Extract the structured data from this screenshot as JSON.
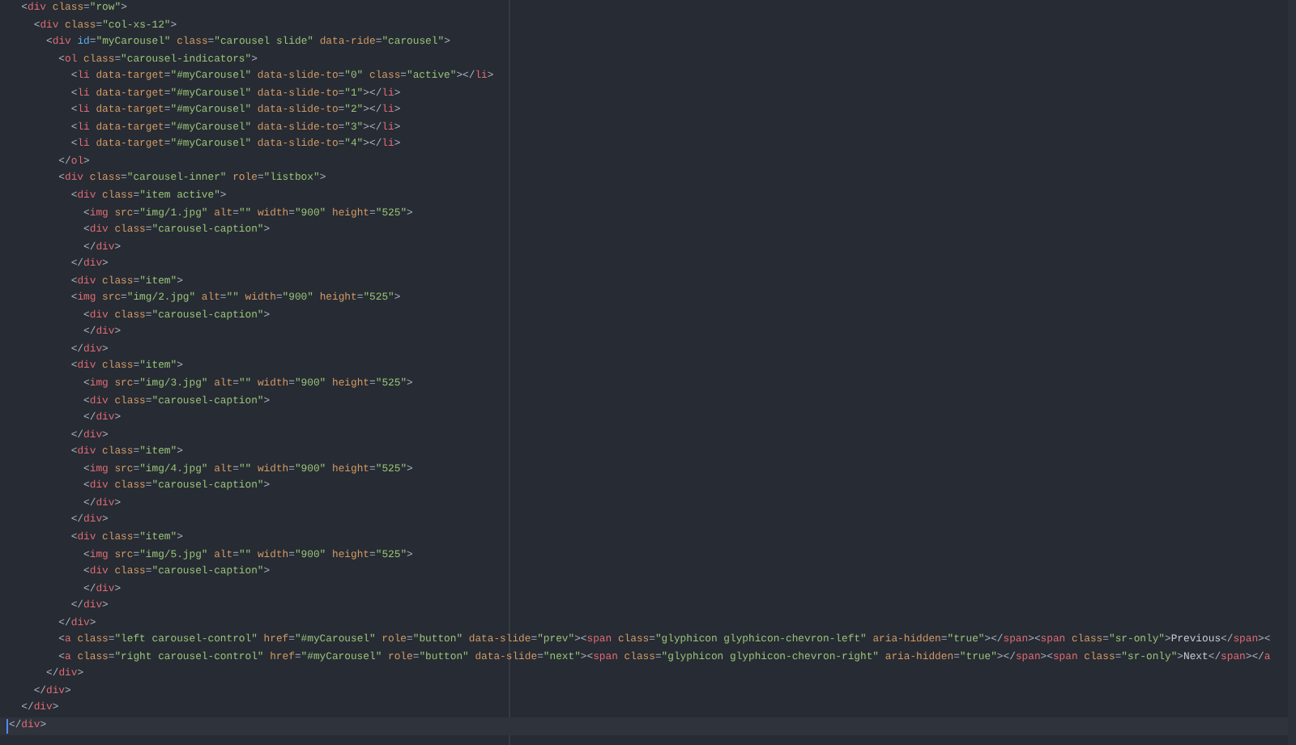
{
  "editor": {
    "lines": [
      {
        "current": false,
        "tokens": [
          {
            "kind": "punct",
            "text": "  <"
          },
          {
            "kind": "tag",
            "text": "div"
          },
          {
            "kind": "attr",
            "text": " class"
          },
          {
            "kind": "punct",
            "text": "="
          },
          {
            "kind": "string",
            "text": "\"row\""
          },
          {
            "kind": "punct",
            "text": ">"
          }
        ]
      },
      {
        "current": false,
        "tokens": [
          {
            "kind": "punct",
            "text": "    <"
          },
          {
            "kind": "tag",
            "text": "div"
          },
          {
            "kind": "attr",
            "text": " class"
          },
          {
            "kind": "punct",
            "text": "="
          },
          {
            "kind": "string",
            "text": "\"col-xs-12\""
          },
          {
            "kind": "punct",
            "text": ">"
          }
        ]
      },
      {
        "current": false,
        "tokens": [
          {
            "kind": "punct",
            "text": "      <"
          },
          {
            "kind": "tag",
            "text": "div"
          },
          {
            "kind": "keyword",
            "text": " id"
          },
          {
            "kind": "punct",
            "text": "="
          },
          {
            "kind": "string",
            "text": "\"myCarousel\""
          },
          {
            "kind": "attr",
            "text": " class"
          },
          {
            "kind": "punct",
            "text": "="
          },
          {
            "kind": "string",
            "text": "\"carousel slide\""
          },
          {
            "kind": "attr",
            "text": " data-ride"
          },
          {
            "kind": "punct",
            "text": "="
          },
          {
            "kind": "string",
            "text": "\"carousel\""
          },
          {
            "kind": "punct",
            "text": ">"
          }
        ]
      },
      {
        "current": false,
        "tokens": [
          {
            "kind": "punct",
            "text": "        <"
          },
          {
            "kind": "tag",
            "text": "ol"
          },
          {
            "kind": "attr",
            "text": " class"
          },
          {
            "kind": "punct",
            "text": "="
          },
          {
            "kind": "string",
            "text": "\"carousel-indicators\""
          },
          {
            "kind": "punct",
            "text": ">"
          }
        ]
      },
      {
        "current": false,
        "tokens": [
          {
            "kind": "punct",
            "text": "          <"
          },
          {
            "kind": "tag",
            "text": "li"
          },
          {
            "kind": "attr",
            "text": " data-target"
          },
          {
            "kind": "punct",
            "text": "="
          },
          {
            "kind": "string",
            "text": "\"#myCarousel\""
          },
          {
            "kind": "attr",
            "text": " data-slide-to"
          },
          {
            "kind": "punct",
            "text": "="
          },
          {
            "kind": "string",
            "text": "\"0\""
          },
          {
            "kind": "attr",
            "text": " class"
          },
          {
            "kind": "punct",
            "text": "="
          },
          {
            "kind": "string",
            "text": "\"active\""
          },
          {
            "kind": "punct",
            "text": "></"
          },
          {
            "kind": "tag",
            "text": "li"
          },
          {
            "kind": "punct",
            "text": ">"
          }
        ]
      },
      {
        "current": false,
        "tokens": [
          {
            "kind": "punct",
            "text": "          <"
          },
          {
            "kind": "tag",
            "text": "li"
          },
          {
            "kind": "attr",
            "text": " data-target"
          },
          {
            "kind": "punct",
            "text": "="
          },
          {
            "kind": "string",
            "text": "\"#myCarousel\""
          },
          {
            "kind": "attr",
            "text": " data-slide-to"
          },
          {
            "kind": "punct",
            "text": "="
          },
          {
            "kind": "string",
            "text": "\"1\""
          },
          {
            "kind": "punct",
            "text": "></"
          },
          {
            "kind": "tag",
            "text": "li"
          },
          {
            "kind": "punct",
            "text": ">"
          }
        ]
      },
      {
        "current": false,
        "tokens": [
          {
            "kind": "punct",
            "text": "          <"
          },
          {
            "kind": "tag",
            "text": "li"
          },
          {
            "kind": "attr",
            "text": " data-target"
          },
          {
            "kind": "punct",
            "text": "="
          },
          {
            "kind": "string",
            "text": "\"#myCarousel\""
          },
          {
            "kind": "attr",
            "text": " data-slide-to"
          },
          {
            "kind": "punct",
            "text": "="
          },
          {
            "kind": "string",
            "text": "\"2\""
          },
          {
            "kind": "punct",
            "text": "></"
          },
          {
            "kind": "tag",
            "text": "li"
          },
          {
            "kind": "punct",
            "text": ">"
          }
        ]
      },
      {
        "current": false,
        "tokens": [
          {
            "kind": "punct",
            "text": "          <"
          },
          {
            "kind": "tag",
            "text": "li"
          },
          {
            "kind": "attr",
            "text": " data-target"
          },
          {
            "kind": "punct",
            "text": "="
          },
          {
            "kind": "string",
            "text": "\"#myCarousel\""
          },
          {
            "kind": "attr",
            "text": " data-slide-to"
          },
          {
            "kind": "punct",
            "text": "="
          },
          {
            "kind": "string",
            "text": "\"3\""
          },
          {
            "kind": "punct",
            "text": "></"
          },
          {
            "kind": "tag",
            "text": "li"
          },
          {
            "kind": "punct",
            "text": ">"
          }
        ]
      },
      {
        "current": false,
        "tokens": [
          {
            "kind": "punct",
            "text": "          <"
          },
          {
            "kind": "tag",
            "text": "li"
          },
          {
            "kind": "attr",
            "text": " data-target"
          },
          {
            "kind": "punct",
            "text": "="
          },
          {
            "kind": "string",
            "text": "\"#myCarousel\""
          },
          {
            "kind": "attr",
            "text": " data-slide-to"
          },
          {
            "kind": "punct",
            "text": "="
          },
          {
            "kind": "string",
            "text": "\"4\""
          },
          {
            "kind": "punct",
            "text": "></"
          },
          {
            "kind": "tag",
            "text": "li"
          },
          {
            "kind": "punct",
            "text": ">"
          }
        ]
      },
      {
        "current": false,
        "tokens": [
          {
            "kind": "punct",
            "text": "        </"
          },
          {
            "kind": "tag",
            "text": "ol"
          },
          {
            "kind": "punct",
            "text": ">"
          }
        ]
      },
      {
        "current": false,
        "tokens": [
          {
            "kind": "punct",
            "text": "        <"
          },
          {
            "kind": "tag",
            "text": "div"
          },
          {
            "kind": "attr",
            "text": " class"
          },
          {
            "kind": "punct",
            "text": "="
          },
          {
            "kind": "string",
            "text": "\"carousel-inner\""
          },
          {
            "kind": "attr",
            "text": " role"
          },
          {
            "kind": "punct",
            "text": "="
          },
          {
            "kind": "string",
            "text": "\"listbox\""
          },
          {
            "kind": "punct",
            "text": ">"
          }
        ]
      },
      {
        "current": false,
        "tokens": [
          {
            "kind": "punct",
            "text": "          <"
          },
          {
            "kind": "tag",
            "text": "div"
          },
          {
            "kind": "attr",
            "text": " class"
          },
          {
            "kind": "punct",
            "text": "="
          },
          {
            "kind": "string",
            "text": "\"item active\""
          },
          {
            "kind": "punct",
            "text": ">"
          }
        ]
      },
      {
        "current": false,
        "tokens": [
          {
            "kind": "punct",
            "text": "            <"
          },
          {
            "kind": "tag",
            "text": "img"
          },
          {
            "kind": "attr",
            "text": " src"
          },
          {
            "kind": "punct",
            "text": "="
          },
          {
            "kind": "string",
            "text": "\"img/1.jpg\""
          },
          {
            "kind": "attr",
            "text": " alt"
          },
          {
            "kind": "punct",
            "text": "="
          },
          {
            "kind": "string",
            "text": "\"\""
          },
          {
            "kind": "attr",
            "text": " width"
          },
          {
            "kind": "punct",
            "text": "="
          },
          {
            "kind": "string",
            "text": "\"900\""
          },
          {
            "kind": "attr",
            "text": " height"
          },
          {
            "kind": "punct",
            "text": "="
          },
          {
            "kind": "string",
            "text": "\"525\""
          },
          {
            "kind": "punct",
            "text": ">"
          }
        ]
      },
      {
        "current": false,
        "tokens": [
          {
            "kind": "punct",
            "text": "            <"
          },
          {
            "kind": "tag",
            "text": "div"
          },
          {
            "kind": "attr",
            "text": " class"
          },
          {
            "kind": "punct",
            "text": "="
          },
          {
            "kind": "string",
            "text": "\"carousel-caption\""
          },
          {
            "kind": "punct",
            "text": ">"
          }
        ]
      },
      {
        "current": false,
        "tokens": [
          {
            "kind": "punct",
            "text": "            </"
          },
          {
            "kind": "tag",
            "text": "div"
          },
          {
            "kind": "punct",
            "text": ">"
          }
        ]
      },
      {
        "current": false,
        "tokens": [
          {
            "kind": "punct",
            "text": "          </"
          },
          {
            "kind": "tag",
            "text": "div"
          },
          {
            "kind": "punct",
            "text": ">"
          }
        ]
      },
      {
        "current": false,
        "tokens": [
          {
            "kind": "punct",
            "text": "          <"
          },
          {
            "kind": "tag",
            "text": "div"
          },
          {
            "kind": "attr",
            "text": " class"
          },
          {
            "kind": "punct",
            "text": "="
          },
          {
            "kind": "string",
            "text": "\"item\""
          },
          {
            "kind": "punct",
            "text": ">"
          }
        ]
      },
      {
        "current": false,
        "tokens": [
          {
            "kind": "punct",
            "text": "          <"
          },
          {
            "kind": "tag",
            "text": "img"
          },
          {
            "kind": "attr",
            "text": " src"
          },
          {
            "kind": "punct",
            "text": "="
          },
          {
            "kind": "string",
            "text": "\"img/2.jpg\""
          },
          {
            "kind": "attr",
            "text": " alt"
          },
          {
            "kind": "punct",
            "text": "="
          },
          {
            "kind": "string",
            "text": "\"\""
          },
          {
            "kind": "attr",
            "text": " width"
          },
          {
            "kind": "punct",
            "text": "="
          },
          {
            "kind": "string",
            "text": "\"900\""
          },
          {
            "kind": "attr",
            "text": " height"
          },
          {
            "kind": "punct",
            "text": "="
          },
          {
            "kind": "string",
            "text": "\"525\""
          },
          {
            "kind": "punct",
            "text": ">"
          }
        ]
      },
      {
        "current": false,
        "tokens": [
          {
            "kind": "punct",
            "text": "            <"
          },
          {
            "kind": "tag",
            "text": "div"
          },
          {
            "kind": "attr",
            "text": " class"
          },
          {
            "kind": "punct",
            "text": "="
          },
          {
            "kind": "string",
            "text": "\"carousel-caption\""
          },
          {
            "kind": "punct",
            "text": ">"
          }
        ]
      },
      {
        "current": false,
        "tokens": [
          {
            "kind": "punct",
            "text": "            </"
          },
          {
            "kind": "tag",
            "text": "div"
          },
          {
            "kind": "punct",
            "text": ">"
          }
        ]
      },
      {
        "current": false,
        "tokens": [
          {
            "kind": "punct",
            "text": "          </"
          },
          {
            "kind": "tag",
            "text": "div"
          },
          {
            "kind": "punct",
            "text": ">"
          }
        ]
      },
      {
        "current": false,
        "tokens": [
          {
            "kind": "punct",
            "text": "          <"
          },
          {
            "kind": "tag",
            "text": "div"
          },
          {
            "kind": "attr",
            "text": " class"
          },
          {
            "kind": "punct",
            "text": "="
          },
          {
            "kind": "string",
            "text": "\"item\""
          },
          {
            "kind": "punct",
            "text": ">"
          }
        ]
      },
      {
        "current": false,
        "tokens": [
          {
            "kind": "punct",
            "text": "            <"
          },
          {
            "kind": "tag",
            "text": "img"
          },
          {
            "kind": "attr",
            "text": " src"
          },
          {
            "kind": "punct",
            "text": "="
          },
          {
            "kind": "string",
            "text": "\"img/3.jpg\""
          },
          {
            "kind": "attr",
            "text": " alt"
          },
          {
            "kind": "punct",
            "text": "="
          },
          {
            "kind": "string",
            "text": "\"\""
          },
          {
            "kind": "attr",
            "text": " width"
          },
          {
            "kind": "punct",
            "text": "="
          },
          {
            "kind": "string",
            "text": "\"900\""
          },
          {
            "kind": "attr",
            "text": " height"
          },
          {
            "kind": "punct",
            "text": "="
          },
          {
            "kind": "string",
            "text": "\"525\""
          },
          {
            "kind": "punct",
            "text": ">"
          }
        ]
      },
      {
        "current": false,
        "tokens": [
          {
            "kind": "punct",
            "text": "            <"
          },
          {
            "kind": "tag",
            "text": "div"
          },
          {
            "kind": "attr",
            "text": " class"
          },
          {
            "kind": "punct",
            "text": "="
          },
          {
            "kind": "string",
            "text": "\"carousel-caption\""
          },
          {
            "kind": "punct",
            "text": ">"
          }
        ]
      },
      {
        "current": false,
        "tokens": [
          {
            "kind": "punct",
            "text": "            </"
          },
          {
            "kind": "tag",
            "text": "div"
          },
          {
            "kind": "punct",
            "text": ">"
          }
        ]
      },
      {
        "current": false,
        "tokens": [
          {
            "kind": "punct",
            "text": "          </"
          },
          {
            "kind": "tag",
            "text": "div"
          },
          {
            "kind": "punct",
            "text": ">"
          }
        ]
      },
      {
        "current": false,
        "tokens": [
          {
            "kind": "punct",
            "text": "          <"
          },
          {
            "kind": "tag",
            "text": "div"
          },
          {
            "kind": "attr",
            "text": " class"
          },
          {
            "kind": "punct",
            "text": "="
          },
          {
            "kind": "string",
            "text": "\"item\""
          },
          {
            "kind": "punct",
            "text": ">"
          }
        ]
      },
      {
        "current": false,
        "tokens": [
          {
            "kind": "punct",
            "text": "            <"
          },
          {
            "kind": "tag",
            "text": "img"
          },
          {
            "kind": "attr",
            "text": " src"
          },
          {
            "kind": "punct",
            "text": "="
          },
          {
            "kind": "string",
            "text": "\"img/4.jpg\""
          },
          {
            "kind": "attr",
            "text": " alt"
          },
          {
            "kind": "punct",
            "text": "="
          },
          {
            "kind": "string",
            "text": "\"\""
          },
          {
            "kind": "attr",
            "text": " width"
          },
          {
            "kind": "punct",
            "text": "="
          },
          {
            "kind": "string",
            "text": "\"900\""
          },
          {
            "kind": "attr",
            "text": " height"
          },
          {
            "kind": "punct",
            "text": "="
          },
          {
            "kind": "string",
            "text": "\"525\""
          },
          {
            "kind": "punct",
            "text": ">"
          }
        ]
      },
      {
        "current": false,
        "tokens": [
          {
            "kind": "punct",
            "text": "            <"
          },
          {
            "kind": "tag",
            "text": "div"
          },
          {
            "kind": "attr",
            "text": " class"
          },
          {
            "kind": "punct",
            "text": "="
          },
          {
            "kind": "string",
            "text": "\"carousel-caption\""
          },
          {
            "kind": "punct",
            "text": ">"
          }
        ]
      },
      {
        "current": false,
        "tokens": [
          {
            "kind": "punct",
            "text": "            </"
          },
          {
            "kind": "tag",
            "text": "div"
          },
          {
            "kind": "punct",
            "text": ">"
          }
        ]
      },
      {
        "current": false,
        "tokens": [
          {
            "kind": "punct",
            "text": "          </"
          },
          {
            "kind": "tag",
            "text": "div"
          },
          {
            "kind": "punct",
            "text": ">"
          }
        ]
      },
      {
        "current": false,
        "tokens": [
          {
            "kind": "punct",
            "text": "          <"
          },
          {
            "kind": "tag",
            "text": "div"
          },
          {
            "kind": "attr",
            "text": " class"
          },
          {
            "kind": "punct",
            "text": "="
          },
          {
            "kind": "string",
            "text": "\"item\""
          },
          {
            "kind": "punct",
            "text": ">"
          }
        ]
      },
      {
        "current": false,
        "tokens": [
          {
            "kind": "punct",
            "text": "            <"
          },
          {
            "kind": "tag",
            "text": "img"
          },
          {
            "kind": "attr",
            "text": " src"
          },
          {
            "kind": "punct",
            "text": "="
          },
          {
            "kind": "string",
            "text": "\"img/5.jpg\""
          },
          {
            "kind": "attr",
            "text": " alt"
          },
          {
            "kind": "punct",
            "text": "="
          },
          {
            "kind": "string",
            "text": "\"\""
          },
          {
            "kind": "attr",
            "text": " width"
          },
          {
            "kind": "punct",
            "text": "="
          },
          {
            "kind": "string",
            "text": "\"900\""
          },
          {
            "kind": "attr",
            "text": " height"
          },
          {
            "kind": "punct",
            "text": "="
          },
          {
            "kind": "string",
            "text": "\"525\""
          },
          {
            "kind": "punct",
            "text": ">"
          }
        ]
      },
      {
        "current": false,
        "tokens": [
          {
            "kind": "punct",
            "text": "            <"
          },
          {
            "kind": "tag",
            "text": "div"
          },
          {
            "kind": "attr",
            "text": " class"
          },
          {
            "kind": "punct",
            "text": "="
          },
          {
            "kind": "string",
            "text": "\"carousel-caption\""
          },
          {
            "kind": "punct",
            "text": ">"
          }
        ]
      },
      {
        "current": false,
        "tokens": [
          {
            "kind": "punct",
            "text": "            </"
          },
          {
            "kind": "tag",
            "text": "div"
          },
          {
            "kind": "punct",
            "text": ">"
          }
        ]
      },
      {
        "current": false,
        "tokens": [
          {
            "kind": "punct",
            "text": "          </"
          },
          {
            "kind": "tag",
            "text": "div"
          },
          {
            "kind": "punct",
            "text": ">"
          }
        ]
      },
      {
        "current": false,
        "tokens": [
          {
            "kind": "punct",
            "text": "        </"
          },
          {
            "kind": "tag",
            "text": "div"
          },
          {
            "kind": "punct",
            "text": ">"
          }
        ]
      },
      {
        "current": false,
        "tokens": [
          {
            "kind": "punct",
            "text": "        <"
          },
          {
            "kind": "tag",
            "text": "a"
          },
          {
            "kind": "attr",
            "text": " class"
          },
          {
            "kind": "punct",
            "text": "="
          },
          {
            "kind": "string",
            "text": "\"left carousel-control\""
          },
          {
            "kind": "attr",
            "text": " href"
          },
          {
            "kind": "punct",
            "text": "="
          },
          {
            "kind": "string",
            "text": "\"#myCarousel\""
          },
          {
            "kind": "attr",
            "text": " role"
          },
          {
            "kind": "punct",
            "text": "="
          },
          {
            "kind": "string",
            "text": "\"button\""
          },
          {
            "kind": "attr",
            "text": " data-slide"
          },
          {
            "kind": "punct",
            "text": "="
          },
          {
            "kind": "string",
            "text": "\"prev\""
          },
          {
            "kind": "punct",
            "text": "><"
          },
          {
            "kind": "tag",
            "text": "span"
          },
          {
            "kind": "attr",
            "text": " class"
          },
          {
            "kind": "punct",
            "text": "="
          },
          {
            "kind": "string",
            "text": "\"glyphicon glyphicon-chevron-left\""
          },
          {
            "kind": "attr",
            "text": " aria-hidden"
          },
          {
            "kind": "punct",
            "text": "="
          },
          {
            "kind": "string",
            "text": "\"true\""
          },
          {
            "kind": "punct",
            "text": "></"
          },
          {
            "kind": "tag",
            "text": "span"
          },
          {
            "kind": "punct",
            "text": "><"
          },
          {
            "kind": "tag",
            "text": "span"
          },
          {
            "kind": "attr",
            "text": " class"
          },
          {
            "kind": "punct",
            "text": "="
          },
          {
            "kind": "string",
            "text": "\"sr-only\""
          },
          {
            "kind": "punct",
            "text": ">"
          },
          {
            "kind": "text",
            "text": "Previous"
          },
          {
            "kind": "punct",
            "text": "</"
          },
          {
            "kind": "tag",
            "text": "span"
          },
          {
            "kind": "punct",
            "text": "><"
          }
        ]
      },
      {
        "current": false,
        "tokens": [
          {
            "kind": "punct",
            "text": "        <"
          },
          {
            "kind": "tag",
            "text": "a"
          },
          {
            "kind": "attr",
            "text": " class"
          },
          {
            "kind": "punct",
            "text": "="
          },
          {
            "kind": "string",
            "text": "\"right carousel-control\""
          },
          {
            "kind": "attr",
            "text": " href"
          },
          {
            "kind": "punct",
            "text": "="
          },
          {
            "kind": "string",
            "text": "\"#myCarousel\""
          },
          {
            "kind": "attr",
            "text": " role"
          },
          {
            "kind": "punct",
            "text": "="
          },
          {
            "kind": "string",
            "text": "\"button\""
          },
          {
            "kind": "attr",
            "text": " data-slide"
          },
          {
            "kind": "punct",
            "text": "="
          },
          {
            "kind": "string",
            "text": "\"next\""
          },
          {
            "kind": "punct",
            "text": "><"
          },
          {
            "kind": "tag",
            "text": "span"
          },
          {
            "kind": "attr",
            "text": " class"
          },
          {
            "kind": "punct",
            "text": "="
          },
          {
            "kind": "string",
            "text": "\"glyphicon glyphicon-chevron-right\""
          },
          {
            "kind": "attr",
            "text": " aria-hidden"
          },
          {
            "kind": "punct",
            "text": "="
          },
          {
            "kind": "string",
            "text": "\"true\""
          },
          {
            "kind": "punct",
            "text": "></"
          },
          {
            "kind": "tag",
            "text": "span"
          },
          {
            "kind": "punct",
            "text": "><"
          },
          {
            "kind": "tag",
            "text": "span"
          },
          {
            "kind": "attr",
            "text": " class"
          },
          {
            "kind": "punct",
            "text": "="
          },
          {
            "kind": "string",
            "text": "\"sr-only\""
          },
          {
            "kind": "punct",
            "text": ">"
          },
          {
            "kind": "text",
            "text": "Next"
          },
          {
            "kind": "punct",
            "text": "</"
          },
          {
            "kind": "tag",
            "text": "span"
          },
          {
            "kind": "punct",
            "text": "></"
          },
          {
            "kind": "tag",
            "text": "a"
          }
        ]
      },
      {
        "current": false,
        "tokens": [
          {
            "kind": "punct",
            "text": "      </"
          },
          {
            "kind": "tag",
            "text": "div"
          },
          {
            "kind": "punct",
            "text": ">"
          }
        ]
      },
      {
        "current": false,
        "tokens": [
          {
            "kind": "punct",
            "text": "    </"
          },
          {
            "kind": "tag",
            "text": "div"
          },
          {
            "kind": "punct",
            "text": ">"
          }
        ]
      },
      {
        "current": false,
        "tokens": [
          {
            "kind": "punct",
            "text": "  </"
          },
          {
            "kind": "tag",
            "text": "div"
          },
          {
            "kind": "punct",
            "text": ">"
          }
        ]
      },
      {
        "current": true,
        "tokens": [
          {
            "kind": "punct",
            "text": "</"
          },
          {
            "kind": "tag",
            "text": "div"
          },
          {
            "kind": "punct",
            "text": ">"
          }
        ]
      }
    ]
  }
}
